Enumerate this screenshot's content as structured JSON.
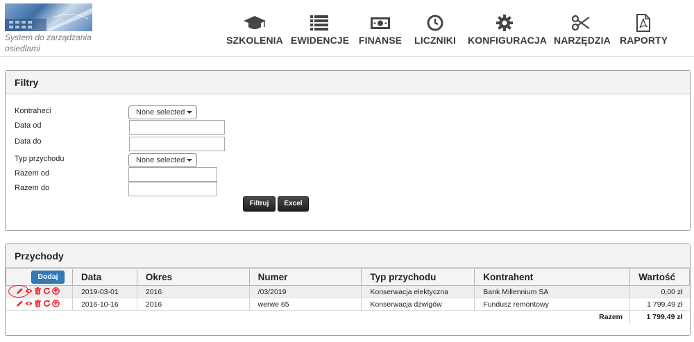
{
  "app": {
    "tagline": "System do zarządzania osiedlami"
  },
  "nav": [
    {
      "label": "SZKOLENIA",
      "icon": "graduation-cap-icon"
    },
    {
      "label": "EWIDENCJE",
      "icon": "list-icon"
    },
    {
      "label": "FINANSE",
      "icon": "money-icon"
    },
    {
      "label": "LICZNIKI",
      "icon": "clock-icon"
    },
    {
      "label": "KONFIGURACJA",
      "icon": "gear-icon"
    },
    {
      "label": "NARZĘDZIA",
      "icon": "scissors-icon"
    },
    {
      "label": "RAPORTY",
      "icon": "pdf-file-icon"
    }
  ],
  "filters": {
    "title": "Filtry",
    "contractors_label": "Kontraheci",
    "contractors_value": "None selected",
    "date_from_label": "Data od",
    "date_from_value": "",
    "date_to_label": "Data do",
    "date_to_value": "",
    "income_type_label": "Typ przychodu",
    "income_type_value": "None selected",
    "total_from_label": "Razem od",
    "total_from_value": "",
    "total_to_label": "Razem do",
    "total_to_value": "",
    "filter_button": "Filtruj",
    "excel_button": "Excel"
  },
  "income": {
    "title": "Przychody",
    "add_button": "Dodaj",
    "columns": {
      "date": "Data",
      "period": "Okres",
      "number": "Numer",
      "type": "Typ przychodu",
      "contractor": "Kontrahent",
      "value": "Wartość"
    },
    "rows": [
      {
        "date": "2019-03-01",
        "period": "2016",
        "number": "/03/2019",
        "type": "Konserwacja elektyczna",
        "contractor": "Bank Millennium SA",
        "value": "0,00 zł"
      },
      {
        "date": "2016-10-16",
        "period": "2016",
        "number": "werwe 65",
        "type": "Konserwacja dzwigów",
        "contractor": "Fundusz remontowy",
        "value": "1 799,49 zł"
      }
    ],
    "total_label": "Razem",
    "total_value": "1 799,49 zł",
    "action_icons": [
      "edit-icon",
      "view-icon",
      "delete-icon",
      "refresh-icon",
      "upload-icon"
    ]
  },
  "colors": {
    "accent_blue": "#337ab7",
    "action_red": "#e5232a",
    "nav_icon": "#444444"
  }
}
